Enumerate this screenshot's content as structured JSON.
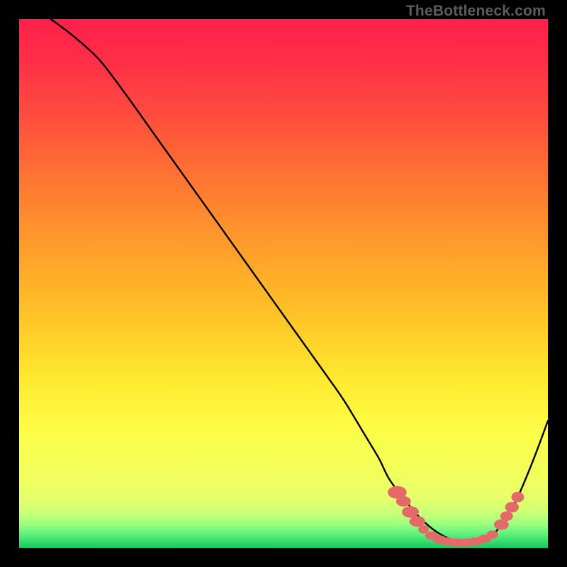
{
  "watermark": "TheBottleneck.com",
  "chart_data": {
    "type": "line",
    "title": "",
    "xlabel": "",
    "ylabel": "",
    "xlim": [
      0,
      100
    ],
    "ylim": [
      0,
      100
    ],
    "grid": false,
    "legend": false,
    "series": [
      {
        "name": "bottleneck-curve",
        "x": [
          6,
          10,
          15,
          20,
          25,
          30,
          35,
          40,
          45,
          50,
          55,
          60,
          62,
          65,
          68,
          70,
          73,
          76,
          79,
          82,
          85,
          88,
          91,
          94,
          97,
          100
        ],
        "y": [
          100,
          97,
          92.5,
          86,
          79,
          72,
          65,
          58,
          51,
          44,
          37,
          30,
          27,
          22,
          17,
          13,
          9,
          5.5,
          3,
          1.5,
          1,
          1.5,
          4,
          9,
          16,
          24
        ]
      }
    ],
    "markers": [
      {
        "name": "curve-marker",
        "x": 71.5,
        "y": 10.5,
        "rx": 1.8,
        "ry": 1.2
      },
      {
        "name": "curve-marker",
        "x": 72.7,
        "y": 8.8,
        "rx": 1.4,
        "ry": 1.0
      },
      {
        "name": "curve-marker",
        "x": 74.0,
        "y": 6.8,
        "rx": 1.6,
        "ry": 1.1
      },
      {
        "name": "curve-marker",
        "x": 75.3,
        "y": 5.0,
        "rx": 1.5,
        "ry": 1.0
      },
      {
        "name": "curve-marker",
        "x": 76.5,
        "y": 3.5,
        "rx": 1.0,
        "ry": 0.8
      },
      {
        "name": "curve-marker",
        "x": 78.0,
        "y": 2.3,
        "rx": 1.2,
        "ry": 0.8
      },
      {
        "name": "curve-marker",
        "x": 79.5,
        "y": 1.6,
        "rx": 1.3,
        "ry": 0.8
      },
      {
        "name": "curve-marker",
        "x": 81.0,
        "y": 1.2,
        "rx": 1.4,
        "ry": 0.8
      },
      {
        "name": "curve-marker",
        "x": 82.7,
        "y": 1.0,
        "rx": 1.4,
        "ry": 0.8
      },
      {
        "name": "curve-marker",
        "x": 84.5,
        "y": 1.0,
        "rx": 1.5,
        "ry": 0.8
      },
      {
        "name": "curve-marker",
        "x": 86.3,
        "y": 1.2,
        "rx": 1.5,
        "ry": 0.8
      },
      {
        "name": "curve-marker",
        "x": 88.0,
        "y": 1.7,
        "rx": 1.3,
        "ry": 0.8
      },
      {
        "name": "curve-marker",
        "x": 89.5,
        "y": 2.5,
        "rx": 1.1,
        "ry": 0.8
      },
      {
        "name": "curve-marker",
        "x": 91.2,
        "y": 4.4,
        "rx": 1.4,
        "ry": 1.0
      },
      {
        "name": "curve-marker",
        "x": 92.2,
        "y": 6.0,
        "rx": 1.2,
        "ry": 0.9
      },
      {
        "name": "curve-marker",
        "x": 93.2,
        "y": 7.7,
        "rx": 1.3,
        "ry": 1.0
      },
      {
        "name": "curve-marker",
        "x": 94.3,
        "y": 9.6,
        "rx": 1.2,
        "ry": 1.0
      }
    ],
    "gradient_stops": [
      {
        "offset": 0.0,
        "color": "#ff1f4b"
      },
      {
        "offset": 0.08,
        "color": "#ff2f47"
      },
      {
        "offset": 0.18,
        "color": "#ff4c3e"
      },
      {
        "offset": 0.3,
        "color": "#ff7433"
      },
      {
        "offset": 0.42,
        "color": "#ff9a2c"
      },
      {
        "offset": 0.55,
        "color": "#ffc027"
      },
      {
        "offset": 0.68,
        "color": "#ffe92f"
      },
      {
        "offset": 0.78,
        "color": "#fdfd47"
      },
      {
        "offset": 0.86,
        "color": "#f1ff5c"
      },
      {
        "offset": 0.905,
        "color": "#e7ff6a"
      },
      {
        "offset": 0.935,
        "color": "#c8ff78"
      },
      {
        "offset": 0.955,
        "color": "#9dff7e"
      },
      {
        "offset": 0.975,
        "color": "#5af07a"
      },
      {
        "offset": 1.0,
        "color": "#17c95f"
      }
    ],
    "marker_color": "#e46a6a",
    "curve_color": "#000000"
  }
}
